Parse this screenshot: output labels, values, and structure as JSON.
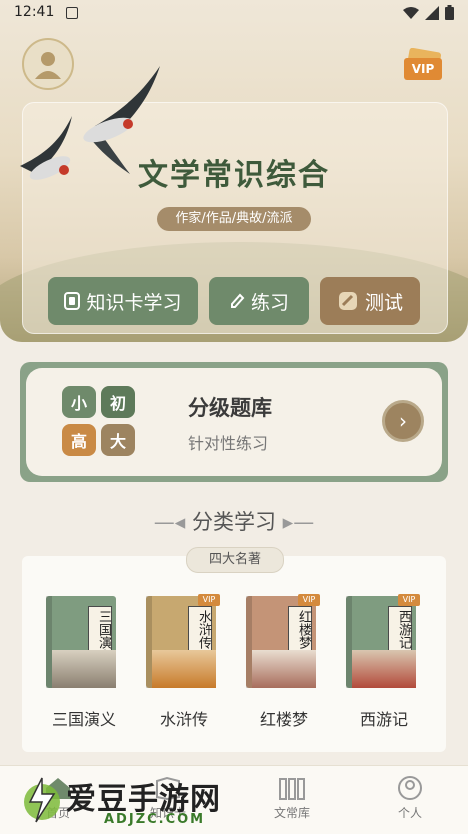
{
  "status": {
    "time": "12:41"
  },
  "hero": {
    "title": "文学常识综合",
    "subtitle": "作家/作品/典故/流派",
    "vip": "VIP",
    "buttons": [
      {
        "label": "知识卡学习"
      },
      {
        "label": "练习"
      },
      {
        "label": "测试"
      }
    ]
  },
  "graded": {
    "chips": [
      "小",
      "初",
      "高",
      "大"
    ],
    "title": "分级题库",
    "subtitle": "针对性练习"
  },
  "section": {
    "title": "分类学习",
    "tag": "四大名著",
    "books": [
      {
        "label": "三国演义",
        "cover": "三国演义",
        "vip": ""
      },
      {
        "label": "水浒传",
        "cover": "水浒传",
        "vip": "VIP"
      },
      {
        "label": "红楼梦",
        "cover": "红楼梦",
        "vip": "VIP"
      },
      {
        "label": "西游记",
        "cover": "西游记",
        "vip": "VIP"
      }
    ]
  },
  "nav": [
    {
      "label": "首页"
    },
    {
      "label": "知识卡"
    },
    {
      "label": "文常库"
    },
    {
      "label": "个人"
    }
  ],
  "watermark": {
    "main": "爱豆手游网",
    "sub": "ADJZC.COM"
  },
  "colors": {
    "green": "#6f8a6b",
    "brown": "#9c7d58",
    "bg": "#f2ede5"
  }
}
